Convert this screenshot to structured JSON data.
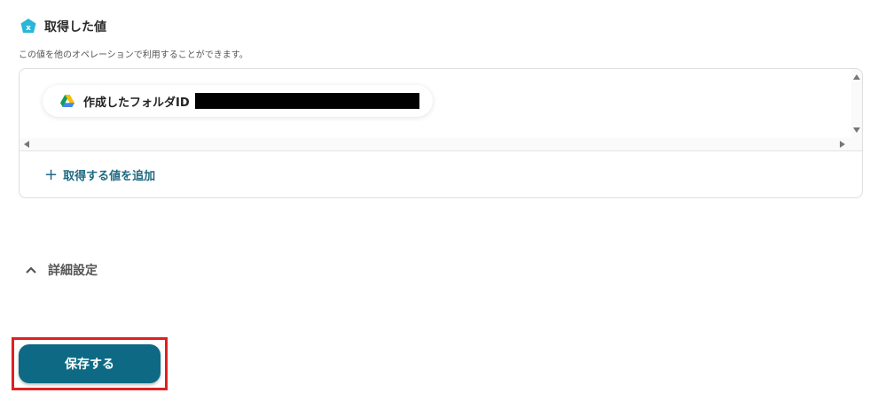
{
  "section": {
    "title": "取得した値",
    "description": "この値を他のオペレーションで利用することができます。",
    "badge_icon": "x-badge-icon",
    "badge_color": "#29b6d9"
  },
  "chip": {
    "icon": "google-drive-icon",
    "label": "作成したフォルダID"
  },
  "add_value": {
    "icon": "plus-icon",
    "label": "取得する値を追加"
  },
  "advanced": {
    "icon": "chevron-up-icon",
    "label": "詳細設定"
  },
  "save": {
    "label": "保存する",
    "color": "#0e6a84",
    "highlight_color": "#e02020"
  },
  "accent_color": "#1f6a82"
}
